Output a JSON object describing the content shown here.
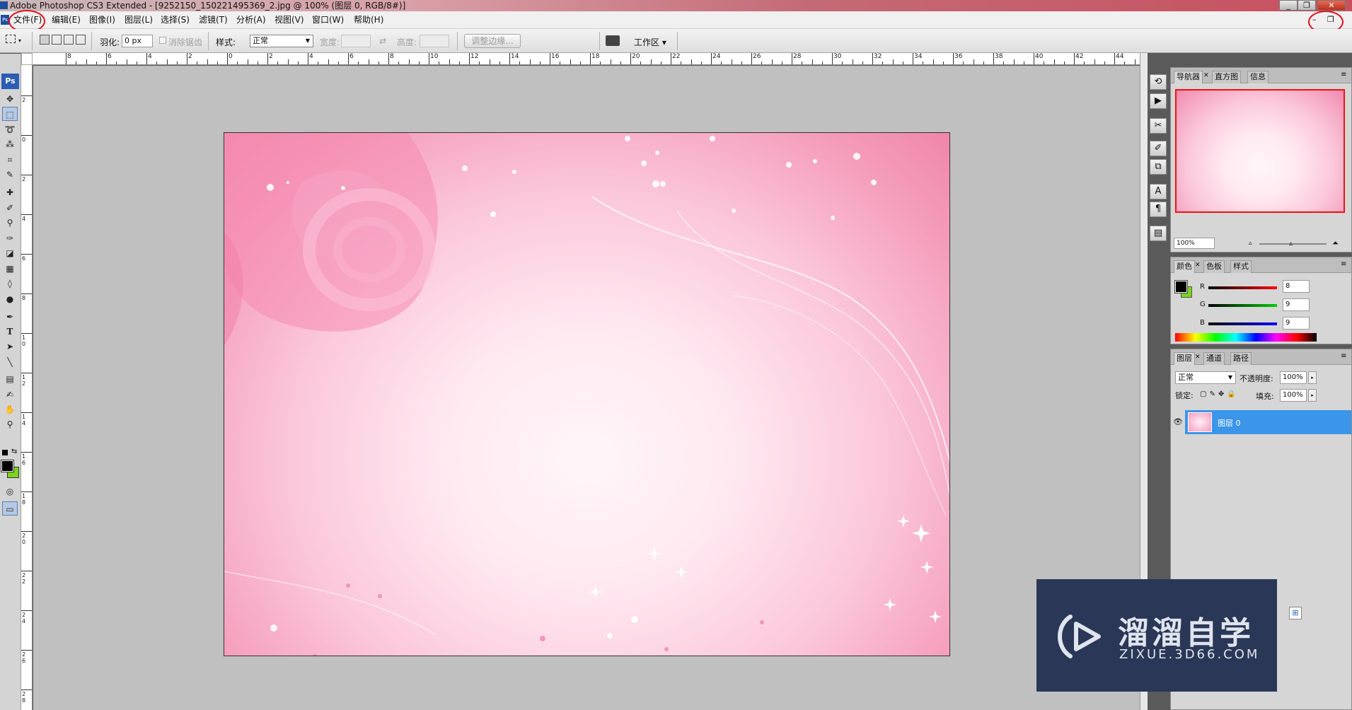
{
  "window": {
    "title": "Adobe Photoshop CS3 Extended - [9252150_150221495369_2.jpg @ 100% (图层 0, RGB/8#)]",
    "minimize": "_",
    "restore": "❐",
    "close": "✕"
  },
  "menu": {
    "items": [
      "文件(F)",
      "编辑(E)",
      "图像(I)",
      "图层(L)",
      "选择(S)",
      "滤镜(T)",
      "分析(A)",
      "视图(V)",
      "窗口(W)",
      "帮助(H)"
    ],
    "doc_minimize": "–",
    "doc_restore": "❐"
  },
  "options": {
    "feather_label": "羽化:",
    "feather_value": "0 px",
    "antialias_label": "消除锯齿",
    "style_label": "样式:",
    "style_value": "正常",
    "width_label": "宽度:",
    "height_label": "高度:",
    "refine_edge": "调整边缘...",
    "workspace": "工作区 ▾"
  },
  "toolbox": {
    "logo": "Ps",
    "tools": [
      "move-icon",
      "marquee-icon",
      "lasso-icon",
      "magic-wand-icon",
      "crop-icon",
      "eyedropper-icon",
      "healing-icon",
      "brush-icon",
      "stamp-icon",
      "history-brush-icon",
      "eraser-icon",
      "gradient-icon",
      "blur-icon",
      "dodge-icon",
      "pen-icon",
      "type-icon",
      "path-select-icon",
      "line-icon",
      "notes-icon",
      "eyedropper2-icon",
      "hand-icon",
      "zoom-icon"
    ],
    "type_glyph": "T"
  },
  "rulers": {
    "horizontal": [
      "8",
      "6",
      "4",
      "2",
      "0",
      "2",
      "4",
      "6",
      "8",
      "10",
      "12",
      "14",
      "16",
      "18",
      "20",
      "22",
      "24",
      "26",
      "28",
      "30",
      "32",
      "34",
      "36",
      "38",
      "40",
      "42",
      "44"
    ],
    "vertical": [
      "2",
      "0",
      "2",
      "4",
      "6",
      "8",
      "10",
      "12",
      "14",
      "16",
      "18",
      "20",
      "22",
      "24",
      "26",
      "28"
    ]
  },
  "navigator": {
    "tabs": [
      "导航器",
      "直方图",
      "信息"
    ],
    "zoom": "100%"
  },
  "color": {
    "tabs": [
      "颜色",
      "色板",
      "样式"
    ],
    "r_label": "R",
    "r_value": "8",
    "g_label": "G",
    "g_value": "9",
    "b_label": "B",
    "b_value": "9",
    "foreground": "#000000",
    "background": "#7cd31e"
  },
  "layers": {
    "tabs": [
      "图层",
      "通道",
      "路径"
    ],
    "blend_mode": "正常",
    "opacity_label": "不透明度:",
    "opacity_value": "100%",
    "lock_label": "锁定:",
    "fill_label": "填充:",
    "fill_value": "100%",
    "layer_name": "图层 0"
  },
  "watermark": {
    "brand_cn": "溜溜自学",
    "brand_url": "ZIXUE.3D66.COM"
  }
}
